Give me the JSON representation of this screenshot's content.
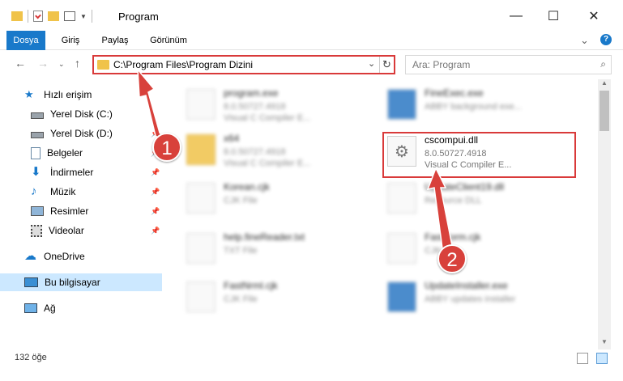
{
  "window": {
    "title": "Program"
  },
  "ribbon": {
    "tabs": [
      "Dosya",
      "Giriş",
      "Paylaş",
      "Görünüm"
    ]
  },
  "navigation": {
    "address": "C:\\Program Files\\Program Dizini",
    "search_placeholder": "Ara: Program"
  },
  "sidebar": {
    "items": [
      {
        "label": "Hızlı erişim",
        "icon": "star-icon"
      },
      {
        "label": "Yerel Disk (C:)",
        "icon": "drive-icon"
      },
      {
        "label": "Yerel Disk (D:)",
        "icon": "drive-icon"
      },
      {
        "label": "Belgeler",
        "icon": "documents-icon"
      },
      {
        "label": "İndirmeler",
        "icon": "download-icon"
      },
      {
        "label": "Müzik",
        "icon": "music-icon"
      },
      {
        "label": "Resimler",
        "icon": "pictures-icon"
      },
      {
        "label": "Videolar",
        "icon": "video-icon"
      },
      {
        "label": "OneDrive",
        "icon": "cloud-icon"
      },
      {
        "label": "Bu bilgisayar",
        "icon": "computer-icon"
      },
      {
        "label": "Ağ",
        "icon": "network-icon"
      }
    ]
  },
  "files": [
    {
      "name": "program.exe",
      "line1": "8.0.50727.4918",
      "line2": "Visual C Compiler E..."
    },
    {
      "name": "FineExec.exe",
      "line1": "ABBY background exe...",
      "line2": ""
    },
    {
      "name": "x64",
      "line1": "8.0.50727.4918",
      "line2": "Visual C Compiler E..."
    },
    {
      "name": "cscompui.dll",
      "line1": "8.0.50727.4918",
      "line2": "Visual C Compiler E..."
    },
    {
      "name": "Korean.cjk",
      "line1": "CJK File",
      "line2": ""
    },
    {
      "name": "UpdateClient19.dll",
      "line1": "Resource DLL",
      "line2": ""
    },
    {
      "name": "help.fineReader.txt",
      "line1": "TXT File",
      "line2": ""
    },
    {
      "name": "FastForm.cjk",
      "line1": "CJK File",
      "line2": ""
    },
    {
      "name": "FastNrml.cjk",
      "line1": "CJK File",
      "line2": ""
    },
    {
      "name": "UpdateInstaller.exe",
      "line1": "ABBY updates installer",
      "line2": ""
    }
  ],
  "status": {
    "item_count": "132 öğe"
  },
  "annotations": {
    "badge1": "1",
    "badge2": "2"
  },
  "colors": {
    "accent": "#1979ca",
    "highlight": "#d93a3a",
    "selection": "#cce8ff"
  }
}
